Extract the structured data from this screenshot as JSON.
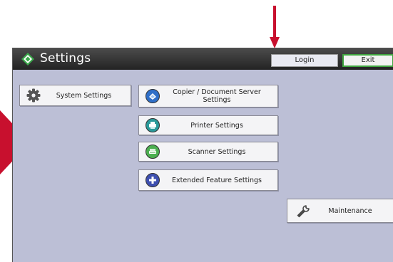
{
  "header": {
    "title": "Settings",
    "login_label": "Login",
    "exit_label": "Exit"
  },
  "buttons": {
    "system_settings": "System Settings",
    "copier_line1": "Copier / Document Server",
    "copier_line2": "Settings",
    "printer": "Printer Settings",
    "scanner": "Scanner Settings",
    "extended": "Extended Feature Settings",
    "maintenance": "Maintenance"
  },
  "icons": {
    "title": "settings-diamond-icon",
    "system": "gear-icon",
    "copier": "copier-icon",
    "printer": "printer-icon",
    "scanner": "scanner-icon",
    "extended": "extended-feature-icon",
    "maintenance": "wrench-icon"
  },
  "colors": {
    "panel_bg": "#bcbfd6",
    "titlebar": "#2c2c2c",
    "exit_border": "#3fa53f",
    "annotation_arrow": "#c8102e",
    "copier_icon": "#2f6fc8",
    "printer_icon": "#2a9a9a",
    "scanner_icon": "#4caf50",
    "extended_icon": "#3d4fb0"
  }
}
